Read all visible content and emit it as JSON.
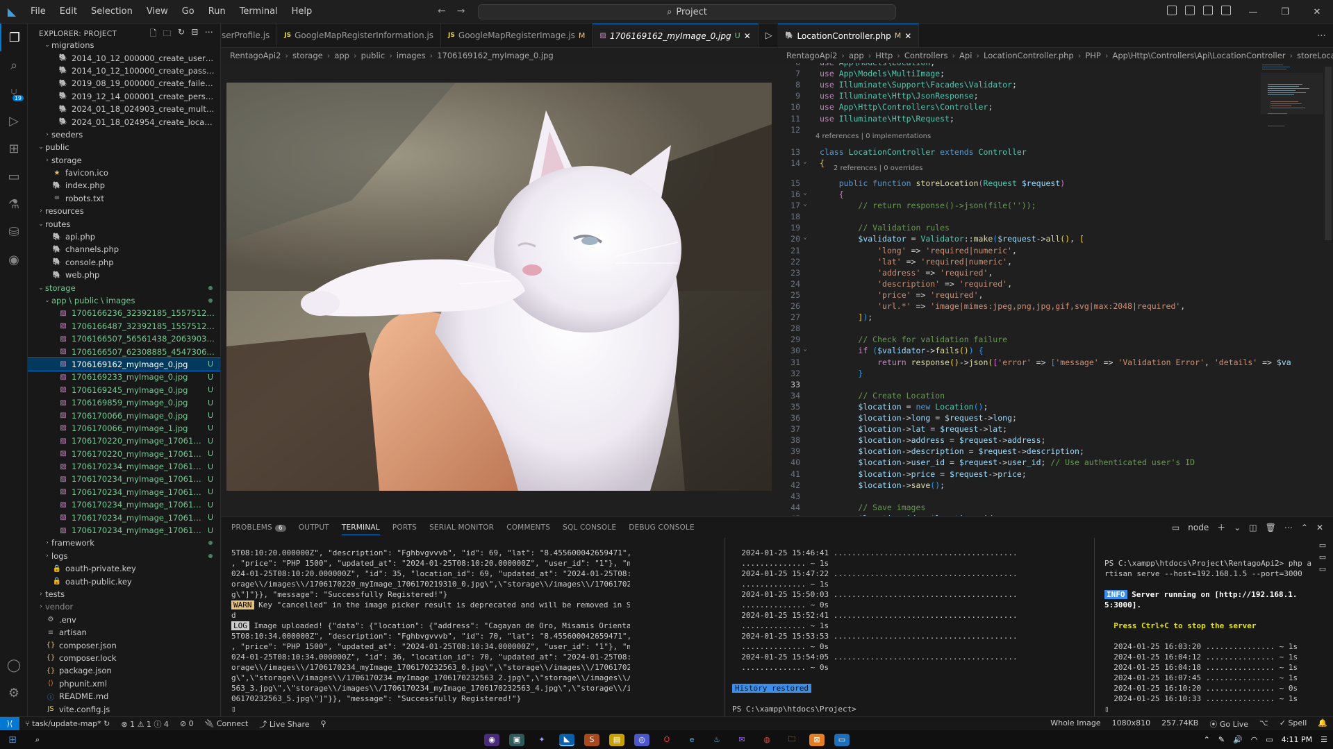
{
  "menu": [
    "File",
    "Edit",
    "Selection",
    "View",
    "Go",
    "Run",
    "Terminal",
    "Help"
  ],
  "search": {
    "label": "Project"
  },
  "explorer": {
    "title": "EXPLORER: PROJECT",
    "items": [
      {
        "label": "migrations",
        "depth": 2,
        "kind": "folder-open"
      },
      {
        "label": "2014_10_12_000000_create_users_table.php",
        "depth": 3,
        "kind": "php"
      },
      {
        "label": "2014_10_12_100000_create_password_reset_t...",
        "depth": 3,
        "kind": "php"
      },
      {
        "label": "2019_08_19_000000_create_failed_jobs_table....",
        "depth": 3,
        "kind": "php"
      },
      {
        "label": "2019_12_14_000001_create_personal_access_t...",
        "depth": 3,
        "kind": "php"
      },
      {
        "label": "2024_01_18_024903_create_multi_images.php",
        "depth": 3,
        "kind": "php"
      },
      {
        "label": "2024_01_18_024954_create_locations.php",
        "depth": 3,
        "kind": "php"
      },
      {
        "label": "seeders",
        "depth": 2,
        "kind": "folder"
      },
      {
        "label": "public",
        "depth": 1,
        "kind": "folder-open"
      },
      {
        "label": "storage",
        "depth": 2,
        "kind": "folder"
      },
      {
        "label": "favicon.ico",
        "depth": 2,
        "kind": "star"
      },
      {
        "label": "index.php",
        "depth": 2,
        "kind": "php"
      },
      {
        "label": "robots.txt",
        "depth": 2,
        "kind": "txt"
      },
      {
        "label": "resources",
        "depth": 1,
        "kind": "folder"
      },
      {
        "label": "routes",
        "depth": 1,
        "kind": "folder-open"
      },
      {
        "label": "api.php",
        "depth": 2,
        "kind": "php"
      },
      {
        "label": "channels.php",
        "depth": 2,
        "kind": "php"
      },
      {
        "label": "console.php",
        "depth": 2,
        "kind": "php"
      },
      {
        "label": "web.php",
        "depth": 2,
        "kind": "php"
      },
      {
        "label": "storage",
        "depth": 1,
        "kind": "folder-open",
        "green": true,
        "dot": true
      },
      {
        "label": "app \\ public \\ images",
        "depth": 2,
        "kind": "folder-open",
        "green": true,
        "dot": true
      },
      {
        "label": "1706166236_32392185_1557512384360016_6...",
        "depth": 3,
        "kind": "img",
        "green": true
      },
      {
        "label": "1706166487_32392185_1557512384360016_6...",
        "depth": 3,
        "kind": "img",
        "green": true
      },
      {
        "label": "1706166507_56561438_2063903500332079_8...",
        "depth": 3,
        "kind": "img",
        "green": true
      },
      {
        "label": "1706166507_62308885_454730655354467_29...",
        "depth": 3,
        "kind": "img",
        "green": true
      },
      {
        "label": "1706169162_myImage_0.jpg",
        "depth": 3,
        "kind": "img",
        "green": true,
        "status": "U",
        "selected": true
      },
      {
        "label": "1706169233_myImage_0.jpg",
        "depth": 3,
        "kind": "img",
        "green": true,
        "status": "U"
      },
      {
        "label": "1706169245_myImage_0.jpg",
        "depth": 3,
        "kind": "img",
        "green": true,
        "status": "U"
      },
      {
        "label": "1706169859_myImage_0.jpg",
        "depth": 3,
        "kind": "img",
        "green": true,
        "status": "U"
      },
      {
        "label": "1706170066_myImage_0.jpg",
        "depth": 3,
        "kind": "img",
        "green": true,
        "status": "U"
      },
      {
        "label": "1706170066_myImage_1.jpg",
        "depth": 3,
        "kind": "img",
        "green": true,
        "status": "U"
      },
      {
        "label": "1706170220_myImage_1706170219310_0...",
        "depth": 3,
        "kind": "img",
        "green": true,
        "status": "U"
      },
      {
        "label": "1706170220_myImage_1706170219310_...",
        "depth": 3,
        "kind": "img",
        "green": true,
        "status": "U"
      },
      {
        "label": "1706170234_myImage_1706170232563_...",
        "depth": 3,
        "kind": "img",
        "green": true,
        "status": "U"
      },
      {
        "label": "1706170234_myImage_1706170232563_...",
        "depth": 3,
        "kind": "img",
        "green": true,
        "status": "U"
      },
      {
        "label": "1706170234_myImage_1706170232563_...",
        "depth": 3,
        "kind": "img",
        "green": true,
        "status": "U"
      },
      {
        "label": "1706170234_myImage_1706170232563_...",
        "depth": 3,
        "kind": "img",
        "green": true,
        "status": "U"
      },
      {
        "label": "1706170234_myImage_1706170232563_...",
        "depth": 3,
        "kind": "img",
        "green": true,
        "status": "U"
      },
      {
        "label": "1706170234_myImage_1706170232563_...",
        "depth": 3,
        "kind": "img",
        "green": true,
        "status": "U"
      },
      {
        "label": "framework",
        "depth": 2,
        "kind": "folder",
        "dot": true
      },
      {
        "label": "logs",
        "depth": 2,
        "kind": "folder",
        "dot": true
      },
      {
        "label": "oauth-private.key",
        "depth": 2,
        "kind": "key"
      },
      {
        "label": "oauth-public.key",
        "depth": 2,
        "kind": "key"
      },
      {
        "label": "tests",
        "depth": 1,
        "kind": "folder"
      },
      {
        "label": "vendor",
        "depth": 1,
        "kind": "folder",
        "dim": true
      },
      {
        "label": ".env",
        "depth": 1,
        "kind": "gear"
      },
      {
        "label": "artisan",
        "depth": 1,
        "kind": "txt"
      },
      {
        "label": "composer.json",
        "depth": 1,
        "kind": "json"
      },
      {
        "label": "composer.lock",
        "depth": 1,
        "kind": "json"
      },
      {
        "label": "package.json",
        "depth": 1,
        "kind": "json"
      },
      {
        "label": "phpunit.xml",
        "depth": 1,
        "kind": "xml"
      },
      {
        "label": "README.md",
        "depth": 1,
        "kind": "info"
      },
      {
        "label": "vite.config.js",
        "depth": 1,
        "kind": "js"
      }
    ]
  },
  "left_tabs": [
    {
      "label": "serProfile.js",
      "icon": "JS",
      "active": false,
      "mark": ""
    },
    {
      "label": "GoogleMapRegisterInformation.js",
      "icon": "JS",
      "active": false,
      "mark": ""
    },
    {
      "label": "GoogleMapRegisterImage.js",
      "icon": "JS",
      "active": false,
      "mark": "M"
    },
    {
      "label": "1706169162_myImage_0.jpg",
      "icon": "img",
      "active": true,
      "mark": "U"
    }
  ],
  "left_breadcrumb": [
    "RentagoApi2",
    "storage",
    "app",
    "public",
    "images",
    "1706169162_myImage_0.jpg"
  ],
  "right_tabs": [
    {
      "label": "LocationController.php",
      "mark": "M"
    }
  ],
  "right_breadcrumb": [
    "RentagoApi2",
    "app",
    "Http",
    "Controllers",
    "Api",
    "LocationController.php",
    "PHP",
    "App\\Http\\Controllers\\Api\\LocationController",
    "storeLocation()"
  ],
  "code": {
    "lens1": "4 references | 0 implementations",
    "lens2": "2 references | 0 overrides",
    "line_numbers": [
      "6",
      "7",
      "8",
      "9",
      "10",
      "11",
      "12",
      "13",
      "14",
      "15",
      "16",
      "17",
      "18",
      "19",
      "20",
      "21",
      "22",
      "23",
      "24",
      "25",
      "26",
      "27",
      "28",
      "29",
      "30",
      "31",
      "32",
      "33",
      "34",
      "35",
      "36",
      "37",
      "38",
      "39",
      "40",
      "41",
      "42",
      "43",
      "44",
      "45"
    ]
  },
  "panel": {
    "tabs": [
      "PROBLEMS",
      "OUTPUT",
      "TERMINAL",
      "PORTS",
      "SERIAL MONITOR",
      "COMMENTS",
      "SQL CONSOLE",
      "DEBUG CONSOLE"
    ],
    "problems_count": "6",
    "terminal_name": "node",
    "term1": [
      "5T08:10:20.000000Z\", \"description\": \"Fghbvgvvvb\", \"id\": 69, \"lat\": \"8.455600042659471\", \"long\": \"124.62487656623125\"",
      ", \"price\": \"PHP 1500\", \"updated_at\": \"2024-01-25T08:10:20.000000Z\", \"user_id\": \"1\"}, \"multiImage\": {\"created_at\": \"2",
      "024-01-25T08:10:20.000000Z\", \"id\": 35, \"location_id\": 69, \"updated_at\": \"2024-01-25T08:10:20.000000Z\", \"url\": \"[\\\"st",
      "orage\\\\/images\\\\/1706170220_myImage_1706170219310_0.jpg\\\",\\\"storage\\\\/images\\\\/1706170220_myImage_1706170219310_1.jp",
      "g\\\"]\"}}, \"message\": \"Successfully Registered!\"}"
    ],
    "warn_tag": "WARN",
    "warn_text": " Key \"cancelled\" in the image picker result is deprecated and will be removed in SDK 48, use \"canceled\" instea",
    "warn_text2": "d",
    "log_tag": "LOG",
    "log_text": " Image uploaded! {\"data\": {\"location\": {\"address\": \"Cagayan de Oro, Misamis Oriental\", \"created_at\": \"2024-01-2",
    "term1b": [
      "5T08:10:34.000000Z\", \"description\": \"Fghbvgvvvb\", \"id\": 70, \"lat\": \"8.455600042659471\", \"long\": \"124.62487656623125\"",
      ", \"price\": \"PHP 1500\", \"updated_at\": \"2024-01-25T08:10:34.000000Z\", \"user_id\": \"1\"}, \"multiImage\": {\"created_at\": \"2",
      "024-01-25T08:10:34.000000Z\", \"id\": 36, \"location_id\": 70, \"updated_at\": \"2024-01-25T08:10:34.000000Z\", \"url\": \"[\\\"st",
      "orage\\\\/images\\\\/1706170234_myImage_1706170232563_0.jpg\\\",\\\"storage\\\\/images\\\\/1706170234_myImage_1706170232563_1.jp",
      "g\\\",\\\"storage\\\\/images\\\\/1706170234_myImage_1706170232563_2.jpg\\\",\\\"storage\\\\/images\\\\/1706170234_myImage_1706170232",
      "563_3.jpg\\\",\\\"storage\\\\/images\\\\/1706170234_myImage_1706170232563_4.jpg\\\",\\\"storage\\\\/images\\\\/1706170234_myImage_17",
      "06170232563_5.jpg\\\"]\"}}, \"message\": \"Successfully Registered!\"}"
    ],
    "term2": [
      "  2024-01-25 15:46:41 .........................................",
      "  .............. ~ 1s",
      "  2024-01-25 15:47:22 .........................................",
      "  .............. ~ 1s",
      "  2024-01-25 15:50:03 .........................................",
      "  .............. ~ 0s",
      "  2024-01-25 15:52:41 .........................................",
      "  .............. ~ 1s",
      "  2024-01-25 15:53:53 .........................................",
      "  .............. ~ 0s",
      "  2024-01-25 15:54:05 .........................................",
      "  .............. ~ 0s"
    ],
    "history": "History restored",
    "prompt2": "PS C:\\xampp\\htdocs\\Project>",
    "term3_prompt": "PS C:\\xampp\\htdocs\\Project\\RentagoApi2> php a",
    "term3_cmd": "rtisan serve --host=192.168.1.5 --port=3000",
    "term3_info_tag": "INFO",
    "term3_info": " Server running on [http://192.168.1.",
    "term3_info2": "5:3000].",
    "term3_stop": "  Press Ctrl+C to stop the server",
    "term3_lines": [
      "  2024-01-25 16:03:20 ............... ~ 1s",
      "  2024-01-25 16:04:12 ............... ~ 1s",
      "  2024-01-25 16:04:18 ............... ~ 1s",
      "  2024-01-25 16:07:45 ............... ~ 1s",
      "  2024-01-25 16:10:20 ............... ~ 0s",
      "  2024-01-25 16:10:33 ............... ~ 1s"
    ]
  },
  "status": {
    "branch": "task/update-map*",
    "sync": "↻",
    "errors": "⊗ 1",
    "warnings": "⚠ 1",
    "info": "ⓘ 4",
    "ports": "⊘ 0",
    "connect": "Connect",
    "liveshare": "Live Share",
    "whole_image": "Whole Image",
    "dims": "1080x810",
    "size": "257.74KB",
    "golive": "Go Live",
    "spell": "✓ Spell"
  },
  "taskbar": {
    "time": "4:11 PM"
  },
  "colors": {
    "accent": "#0078d4",
    "untracked": "#73c991",
    "modified": "#e2c08d"
  }
}
